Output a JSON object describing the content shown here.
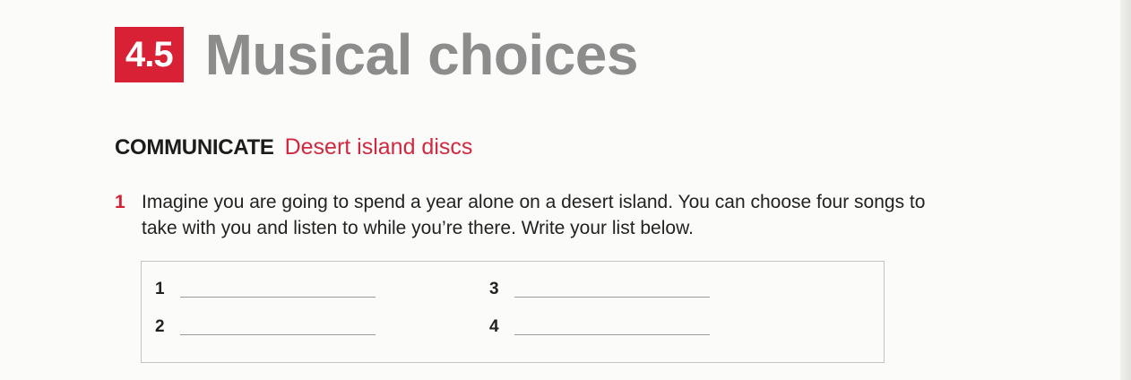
{
  "header": {
    "unit_number": "4.5",
    "unit_title": "Musical choices"
  },
  "section": {
    "label": "COMMUNICATE",
    "topic": "Desert island discs"
  },
  "exercise": {
    "number": "1",
    "instruction": "Imagine you are going to spend a year alone on a desert island. You can choose four songs to take with you and listen to while you’re there. Write your list below."
  },
  "answer_box": {
    "items": [
      {
        "number": "1",
        "value": ""
      },
      {
        "number": "2",
        "value": ""
      },
      {
        "number": "3",
        "value": ""
      },
      {
        "number": "4",
        "value": ""
      }
    ]
  },
  "colors": {
    "accent_red": "#d92136",
    "title_gray": "#8c8c8c",
    "topic_red": "#d0293f"
  }
}
